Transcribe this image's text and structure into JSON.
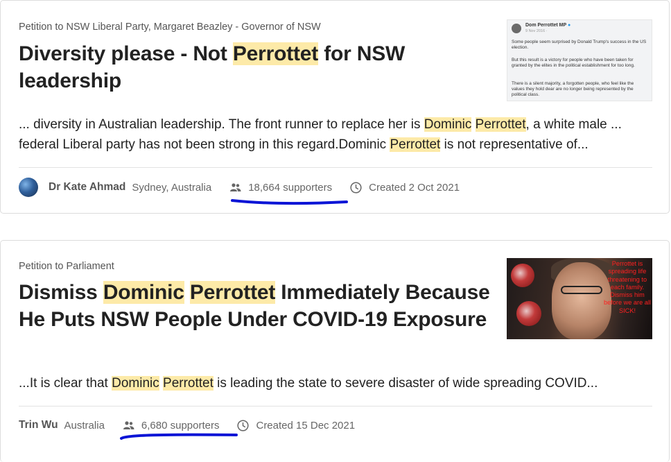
{
  "petitions": [
    {
      "target": "Petition to NSW Liberal Party, Margaret Beazley - Governor of NSW",
      "title_parts": [
        "Diversity please - Not ",
        "Perrottet",
        " for NSW leadership"
      ],
      "excerpt_parts": [
        "... diversity in Australian leadership. The front runner to replace her is ",
        "Dominic",
        " ",
        "Perrottet",
        ", a white male ... federal Liberal party has not been strong in this regard.Dominic ",
        "Perrottet",
        " is not representative of..."
      ],
      "author": "Dr Kate Ahmad",
      "location": "Sydney, Australia",
      "supporters": "18,664 supporters",
      "created": "Created 2 Oct 2021",
      "thumbnail": {
        "name": "Dom Perrottet MP",
        "time": "9 Nov 2016 · ",
        "paragraphs": [
          "Some people seem surprised by Donald Trump's success in the US election.",
          "But this result is a victory for people who have been taken for granted by the elites in the political establishment for too long.",
          "There is a silent majority, a forgotten people, who feel like the values they hold dear are no longer being represented by the political class."
        ]
      }
    },
    {
      "target": "Petition to Parliament",
      "title_parts": [
        "Dismiss ",
        "Dominic",
        " ",
        "Perrottet",
        " Immediately Because He Puts NSW People Under COVID-19 Exposure"
      ],
      "excerpt_parts": [
        "...It is clear that ",
        "Dominic",
        " ",
        "Perrottet",
        " is leading the state to severe disaster of wide spreading COVID..."
      ],
      "author": "Trin Wu",
      "location": "Australia",
      "supporters": "6,680 supporters",
      "created": "Created 15 Dec 2021",
      "thumbnail": {
        "overlay_text": "Perrottet is spreading life threatening to each family. Dismiss him before we are all SICK!"
      }
    }
  ],
  "colors": {
    "highlight": "#fdeaa8",
    "annotation_underline": "#0a14d6",
    "overlay_text": "#ff2020"
  }
}
